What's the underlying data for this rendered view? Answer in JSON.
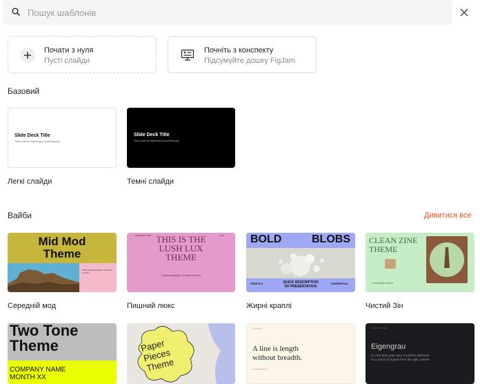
{
  "search": {
    "placeholder": "Пошук шаблонів"
  },
  "cards": [
    {
      "title": "Почати з нуля",
      "subtitle": "Пусті слайди"
    },
    {
      "title": "Почніть з конспекту",
      "subtitle": "Підсумуйте дошку FigJam"
    }
  ],
  "sections": {
    "basic": "Базовий",
    "vibes": "Вайби",
    "see_all": "Дивитися все"
  },
  "basic_templates": [
    {
      "label": "Легкі слайди",
      "slide_title": "Slide Deck Title",
      "slide_sub": "This is just the beginning of something big."
    },
    {
      "label": "Темні слайди",
      "slide_title": "Slide Deck Title",
      "slide_sub": "This is just the beginning of something big."
    }
  ],
  "vibe_templates": [
    {
      "label": "Середній мод",
      "title_1": "Mid Mod",
      "title_2": "Theme",
      "caption": "Add a quick description of what's to come"
    },
    {
      "label": "Пишний люкс",
      "title_1": "THIS IS THE",
      "title_2": "LUSH LUX",
      "title_3": "THEME",
      "caption": "A quick description of what's to come",
      "corner_left": "PRESENTER NAME",
      "corner_right": "DATE"
    },
    {
      "label": "Жирні краплі",
      "title_1": "BOLD",
      "title_2": "BLOBS",
      "caption_1": "QUICK DESCRIPTION",
      "caption_2": "OF PRESENTATION",
      "left": "PRIVATE &",
      "right": "CONFIDENTIAL"
    },
    {
      "label": "Чистий Зін",
      "title_1": "CLEAN ZINE",
      "title_2": "THEME",
      "caption": "Presentation Name"
    }
  ],
  "row3_templates": [
    {
      "title_1": "Two Tone",
      "title_2": "Theme",
      "line_1": "COMPANY NAME",
      "line_2": "MONTH XX"
    },
    {
      "title_1": "Paper",
      "title_2": "Pieces",
      "title_3": "Theme"
    },
    {
      "top": "COMPANY",
      "title_1": "A line is length",
      "title_2": "without breadth."
    },
    {
      "top": "AUTHOR NAME",
      "title": "Eigengrau",
      "sub_1": "(n.) the dark gray seen in perfect darkness",
      "sub_2": "as a result of signals from the optic nerves"
    }
  ],
  "colors": {
    "accent": "#f24e1e",
    "mid_mod_olive": "#c6b63c",
    "lush_pink": "#e49bcb",
    "blobs_blue": "#9fa8f5",
    "zine_green": "#c6edc6",
    "two_tone_yellow": "#eaff00",
    "paper_yellow": "#f0f070",
    "line_cream": "#fbf6e8",
    "eigengrau": "#1a1c20"
  },
  "icons": {
    "search": "search-icon",
    "close": "close-icon",
    "plus": "plus-icon",
    "outline": "outline-icon"
  }
}
